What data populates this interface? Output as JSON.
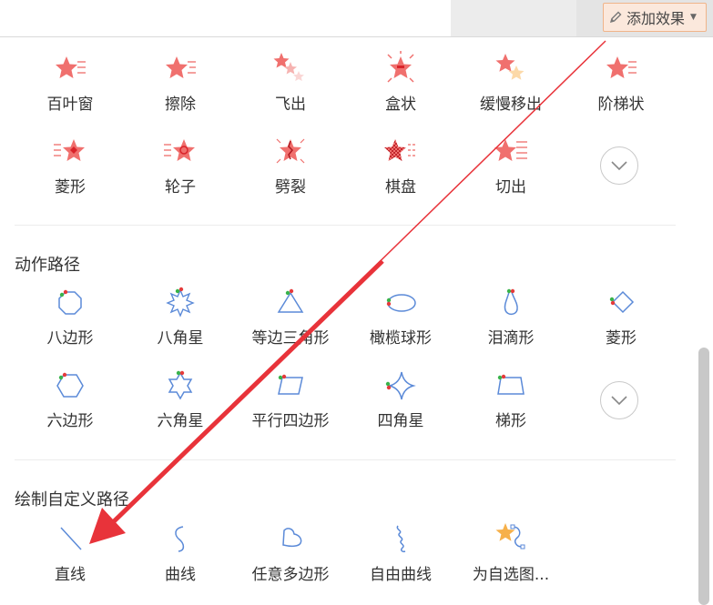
{
  "toolbar": {
    "add_effect_label": "添加效果"
  },
  "exit_effects": [
    {
      "label": "百叶窗",
      "icon": "blinds-star-icon"
    },
    {
      "label": "擦除",
      "icon": "wipe-star-icon"
    },
    {
      "label": "飞出",
      "icon": "fly-out-star-icon"
    },
    {
      "label": "盒状",
      "icon": "box-star-icon"
    },
    {
      "label": "缓慢移出",
      "icon": "crawl-out-star-icon"
    },
    {
      "label": "阶梯状",
      "icon": "stairs-star-icon"
    },
    {
      "label": "菱形",
      "icon": "diamond-star-icon"
    },
    {
      "label": "轮子",
      "icon": "wheel-star-icon"
    },
    {
      "label": "劈裂",
      "icon": "split-star-icon"
    },
    {
      "label": "棋盘",
      "icon": "checkerboard-star-icon"
    },
    {
      "label": "切出",
      "icon": "cut-out-star-icon"
    }
  ],
  "motion_paths": {
    "title": "动作路径",
    "items": [
      {
        "label": "八边形",
        "icon": "octagon-path-icon"
      },
      {
        "label": "八角星",
        "icon": "eight-point-star-path-icon"
      },
      {
        "label": "等边三角形",
        "icon": "triangle-path-icon"
      },
      {
        "label": "橄榄球形",
        "icon": "football-path-icon"
      },
      {
        "label": "泪滴形",
        "icon": "teardrop-path-icon"
      },
      {
        "label": "菱形",
        "icon": "diamond-path-icon"
      },
      {
        "label": "六边形",
        "icon": "hexagon-path-icon"
      },
      {
        "label": "六角星",
        "icon": "six-point-star-path-icon"
      },
      {
        "label": "平行四边形",
        "icon": "parallelogram-path-icon"
      },
      {
        "label": "四角星",
        "icon": "four-point-star-path-icon"
      },
      {
        "label": "梯形",
        "icon": "trapezoid-path-icon"
      }
    ]
  },
  "custom_paths": {
    "title": "绘制自定义路径",
    "items": [
      {
        "label": "直线",
        "icon": "line-path-icon"
      },
      {
        "label": "曲线",
        "icon": "curve-path-icon"
      },
      {
        "label": "任意多边形",
        "icon": "freeform-polygon-icon"
      },
      {
        "label": "自由曲线",
        "icon": "scribble-path-icon"
      },
      {
        "label": "为自选图...",
        "icon": "shape-path-icon"
      }
    ]
  },
  "colors": {
    "star": "#f0706e",
    "path": "#5b8ad8",
    "accent_border": "#f0b48a",
    "arrow": "#e8333a"
  }
}
